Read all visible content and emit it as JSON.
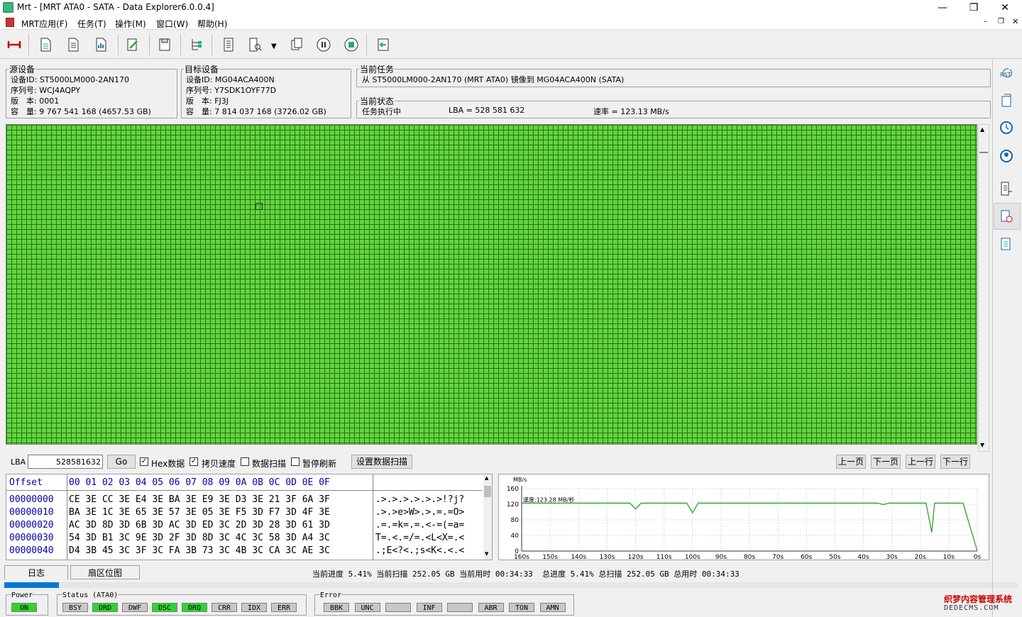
{
  "window": {
    "title": "Mrt - [MRT ATA0 - SATA - Data Explorer6.0.0.4]"
  },
  "menu": [
    "MRT应用(F)",
    "任务(T)",
    "操作(M)",
    "窗口(W)",
    "帮助(H)"
  ],
  "source": {
    "legend": "源设备",
    "lines": [
      "设备ID: ST5000LM000-2AN170",
      "序列号: WCJ4AQPY",
      "版　本: 0001",
      "容　量: 9 767 541 168 (4657.53 GB)"
    ]
  },
  "target": {
    "legend": "目标设备",
    "lines": [
      "设备ID: MG04ACA400N",
      "序列号: Y7SDK1OYF77D",
      "版　本: FJ3J",
      "容　量: 7 814 037 168 (3726.02 GB)"
    ]
  },
  "task": {
    "legend": "当前任务",
    "text": "从 ST5000LM000-2AN170 (MRT ATA0) 镜像到 MG04ACA400N (SATA)"
  },
  "status": {
    "legend": "当前状态",
    "state": "任务执行中",
    "lba": "LBA = 528 581 632",
    "speed": "速率 = 123.13 MB/s"
  },
  "controls": {
    "lba_label": "LBA",
    "lba_value": "528581632",
    "go": "Go",
    "hex_check": "Hex数据",
    "copy_speed_check": "拷贝速度",
    "data_scan_check": "数据扫描",
    "pause_refresh_check": "暂停刷新",
    "set_scan_button": "设置数据扫描",
    "prev_page": "上一页",
    "next_page": "下一页",
    "prev_line": "上一行",
    "next_line": "下一行"
  },
  "hex": {
    "offset_header": "Offset",
    "col_header": "00 01 02 03 04 05 06 07 08 09 0A 0B 0C 0D 0E 0F",
    "rows": [
      {
        "offset": "00000000",
        "bytes": "CE 3E CC 3E E4 3E BA 3E E9 3E D3 3E 21 3F 6A 3F",
        "ascii": ".>.>.>.>.>.>!?j?"
      },
      {
        "offset": "00000010",
        "bytes": "BA 3E 1C 3E 65 3E 57 3E 05 3E F5 3D F7 3D 4F 3E",
        "ascii": ".>.>e>W>.>.=.=O>"
      },
      {
        "offset": "00000020",
        "bytes": "AC 3D 8D 3D 6B 3D AC 3D ED 3C 2D 3D 28 3D 61 3D",
        "ascii": ".=.=k=.=.<-=(=a="
      },
      {
        "offset": "00000030",
        "bytes": "54 3D B1 3C 9E 3D 2F 3D 8D 3C 4C 3C 58 3D A4 3C",
        "ascii": "T=.<.=/=.<L<X=.<"
      },
      {
        "offset": "00000040",
        "bytes": "D4 3B 45 3C 3F 3C FA 3B 73 3C 4B 3C CA 3C AE 3C",
        "ascii": ".;E<?<.;s<K<.<.<"
      }
    ]
  },
  "chart_data": {
    "type": "line",
    "ylabel": "MB/s",
    "annotation": "速度:123.28 MB/秒",
    "ylim": [
      0,
      160
    ],
    "yticks": [
      "160",
      "120",
      "80",
      "40",
      "0"
    ],
    "xticks": [
      "160s",
      "150s",
      "140s",
      "130s",
      "120s",
      "110s",
      "100s",
      "90s",
      "80s",
      "70s",
      "60s",
      "50s",
      "40s",
      "30s",
      "20s",
      "10s",
      "0s"
    ],
    "series": [
      {
        "x": [
          160,
          150,
          140,
          130,
          122,
          120,
          118,
          110,
          102,
          100,
          98,
          90,
          80,
          70,
          60,
          50,
          40,
          35,
          33,
          31,
          25,
          18,
          16,
          15,
          14,
          12,
          10,
          5,
          0
        ],
        "y": [
          123,
          123,
          123,
          123,
          123,
          108,
          123,
          123,
          123,
          98,
          123,
          123,
          123,
          123,
          123,
          123,
          123,
          123,
          119,
          123,
          123,
          123,
          48,
          123,
          123,
          123,
          123,
          123,
          0
        ],
        "color": "#1aa01a"
      }
    ]
  },
  "tabs": [
    "日志",
    "扇区位图"
  ],
  "progress": {
    "text": "当前进度 5.41% 当前扫描 252.05 GB 当前用时 00:34:33",
    "total_text": "总进度 5.41% 总扫描 252.05 GB 总用时 00:34:33",
    "fraction": 0.0541
  },
  "statusbar": {
    "power_label": "Power",
    "power": [
      {
        "t": "ON",
        "on": true
      }
    ],
    "status_label": "Status (ATA0)",
    "status": [
      {
        "t": "BSY",
        "on": false
      },
      {
        "t": "DRD",
        "on": true
      },
      {
        "t": "DWF",
        "on": false
      },
      {
        "t": "DSC",
        "on": true
      },
      {
        "t": "DRQ",
        "on": true
      },
      {
        "t": "CRR",
        "on": false
      },
      {
        "t": "IDX",
        "on": false
      },
      {
        "t": "ERR",
        "on": false
      }
    ],
    "error_label": "Error",
    "error": [
      {
        "t": "BBK",
        "on": false
      },
      {
        "t": "UNC",
        "on": false
      },
      {
        "t": "",
        "on": false
      },
      {
        "t": "INF",
        "on": false
      },
      {
        "t": "",
        "on": false
      },
      {
        "t": "ABR",
        "on": false
      },
      {
        "t": "TON",
        "on": false
      },
      {
        "t": "AMN",
        "on": false
      }
    ]
  },
  "watermark": {
    "line1": "织梦内容管理系统",
    "line2": "DEDECMS.COM"
  },
  "colors": {
    "map_green": "#66d33c",
    "led_on": "#2ed52e",
    "progress": "#0078d7"
  }
}
